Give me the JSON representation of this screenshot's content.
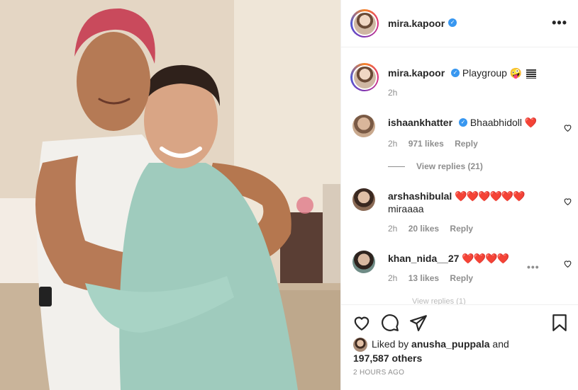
{
  "post": {
    "author": "mira.kapoor",
    "verified_mark": "✓",
    "more_icon": "•••"
  },
  "caption": {
    "author": "mira.kapoor",
    "text": "Playgroup 🤪",
    "time": "2h"
  },
  "comments": [
    {
      "author": "ishaankhatter",
      "verified": true,
      "text": "Bhaabhidoll",
      "hearts": "❤️",
      "time": "2h",
      "likes": "971 likes",
      "reply": "Reply",
      "avatar_color": "#c9a98e"
    },
    {
      "author": "arshashibulal",
      "verified": false,
      "text": "",
      "hearts": "❤️❤️❤️❤️❤️❤️",
      "text2": "miraaaa",
      "time": "2h",
      "likes": "20 likes",
      "reply": "Reply",
      "avatar_color": "#8a6a55"
    },
    {
      "author": "khan_nida__27",
      "verified": false,
      "text": "",
      "hearts": "❤️❤️❤️❤️",
      "time": "2h",
      "likes": "13 likes",
      "reply": "Reply",
      "avatar_color": "#6f8c86"
    }
  ],
  "view_replies": "View replies (21)",
  "view_replies_faded": "View replies (1)",
  "comment_more": "•••",
  "liked_by": {
    "prefix": "Liked by",
    "user": "anusha_puppala",
    "connector": "and",
    "others": "197,587 others"
  },
  "timestamp": "2 HOURS AGO",
  "icons": [
    "heart-icon",
    "comment-icon",
    "share-icon",
    "bookmark-icon",
    "more-icon",
    "verified-icon"
  ],
  "colors": {
    "verified": "#3897f0",
    "heart": "#e0245e",
    "muted": "#8e8e8e"
  }
}
